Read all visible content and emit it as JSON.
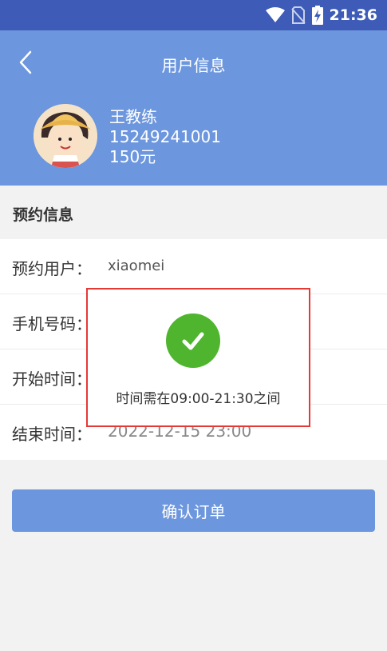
{
  "status_bar": {
    "time": "21:36",
    "icons": [
      "wifi-icon",
      "no-sim-icon",
      "battery-charging-icon"
    ]
  },
  "header": {
    "title": "用户信息",
    "back_icon": "chevron-left-icon"
  },
  "user": {
    "name": "王教练",
    "phone": "15249241001",
    "balance": "150元"
  },
  "section": {
    "title": "预约信息"
  },
  "form": {
    "rows": [
      {
        "label": "预约用户：",
        "value": "xiaomei"
      },
      {
        "label": "手机号码：",
        "value": ""
      },
      {
        "label": "开始时间：",
        "value": ""
      },
      {
        "label": "结束时间：",
        "value": "2022-12-15 23:00"
      }
    ]
  },
  "button": {
    "label": "确认订单"
  },
  "toast": {
    "icon": "checkmark-icon",
    "message": "时间需在09:00-21:30之间"
  },
  "colors": {
    "header_bg": "#6c96dd",
    "status_bar_bg": "#3d5bb7",
    "toast_border": "#e53935",
    "check_green": "#4fb52e"
  }
}
